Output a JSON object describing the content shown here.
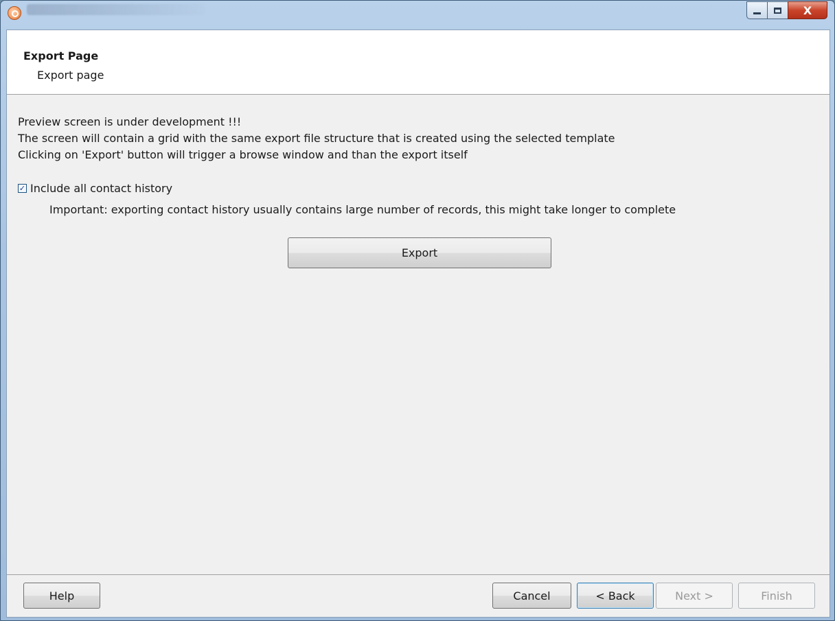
{
  "window": {
    "icon": "magnifier-app-icon",
    "controls": {
      "minimize": "minimize-icon",
      "maximize": "maximize-icon",
      "close_label": "X"
    }
  },
  "header": {
    "title": "Export Page",
    "subtitle": "Export page"
  },
  "content": {
    "lines": [
      "Preview screen is under development !!!",
      "The screen will contain a grid with the same export file structure that is created using the selected template",
      "Clicking on 'Export' button will trigger a browse window and than the export itself"
    ],
    "include_history": {
      "checked": true,
      "label": "Include all contact history",
      "note": "Important: exporting contact history usually contains large number of records, this might take longer to complete"
    },
    "export_button": "Export"
  },
  "footer": {
    "help": "Help",
    "cancel": "Cancel",
    "back": "< Back",
    "next": "Next >",
    "finish": "Finish"
  }
}
